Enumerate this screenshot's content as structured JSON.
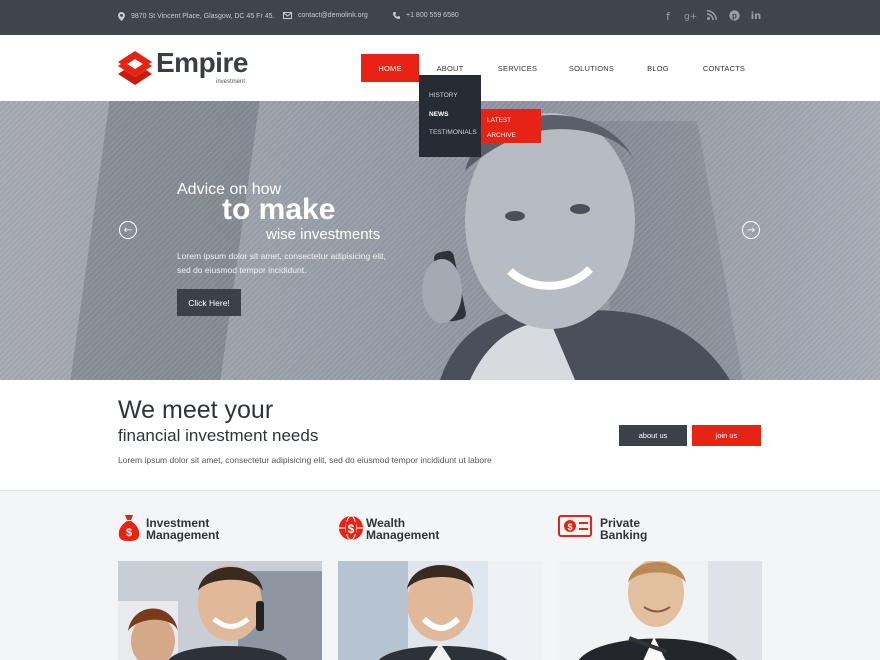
{
  "topbar": {
    "address": "9870 St Vincent Place, Glasgow, DC 45 Fr 45.",
    "email": "contact@demolink.org",
    "phone": "+1 800 559 6580",
    "social_icons": [
      "facebook-icon",
      "google-plus-icon",
      "rss-icon",
      "pinterest-icon",
      "linkedin-icon"
    ]
  },
  "brand": {
    "name": "Empire",
    "tagline": "investment",
    "accent": "#e62314"
  },
  "nav": {
    "items": [
      {
        "label": "HOME",
        "active": true
      },
      {
        "label": "ABOUT"
      },
      {
        "label": "SERVICES"
      },
      {
        "label": "SOLUTIONS"
      },
      {
        "label": "BLOG"
      },
      {
        "label": "CONTACTS"
      }
    ],
    "about_dropdown": [
      "HISTORY",
      "NEWS",
      "TESTIMONIALS"
    ],
    "news_submenu": [
      "LATEST",
      "ARCHIVE"
    ]
  },
  "hero": {
    "line1": "Advice on how",
    "line2": "to make",
    "line3": "wise investments",
    "text": "Lorem ipsum dolor sit amet, consectetur adipisicing elit, sed do eiusmod tempor incididunt.",
    "button": "Click Here!"
  },
  "intro": {
    "title": "We meet your",
    "subtitle": "financial investment needs",
    "text": "Lorem ipsum dolor sit amet, consectetur adipisicing elit, sed do eiusmod tempor incididunt ut labore",
    "about_button": "about us",
    "join_button": "join us"
  },
  "services": [
    {
      "title_line1": "Investment",
      "title_line2": "Management",
      "icon": "money-bag-icon"
    },
    {
      "title_line1": "Wealth",
      "title_line2": "Management",
      "icon": "globe-dollar-icon"
    },
    {
      "title_line1": "Private",
      "title_line2": "Banking",
      "icon": "banknote-icon"
    }
  ]
}
